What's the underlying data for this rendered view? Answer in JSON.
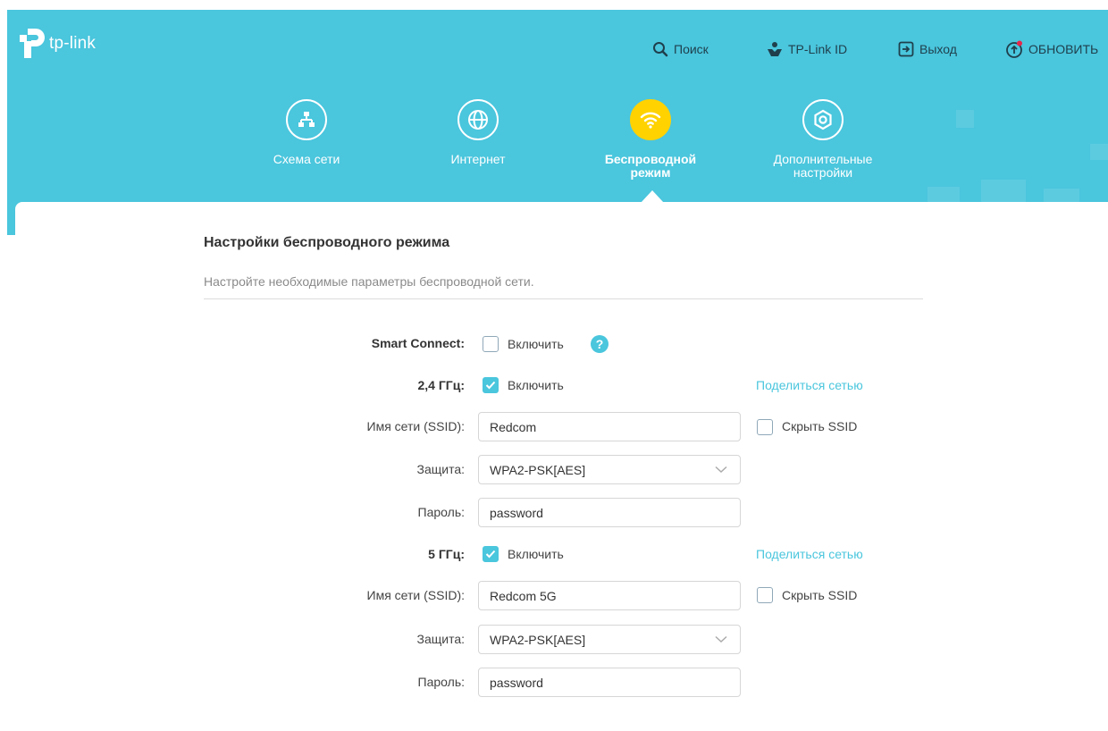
{
  "header": {
    "logo_text": "tp-link",
    "top_links": {
      "search": "Поиск",
      "tplink_id": "TP-Link ID",
      "logout": "Выход",
      "update": "ОБНОВИТЬ"
    },
    "nav": [
      {
        "line1": "Схема сети",
        "line2": "",
        "icon": "network-map-icon"
      },
      {
        "line1": "Интернет",
        "line2": "",
        "icon": "globe-icon"
      },
      {
        "line1": "Беспроводной",
        "line2": "режим",
        "icon": "wifi-icon",
        "active": true
      },
      {
        "line1": "Дополнительные",
        "line2": "настройки",
        "icon": "advanced-settings-icon"
      }
    ],
    "colors": {
      "primary": "#4ac6dd",
      "active_tab": "#ffd200"
    }
  },
  "section": {
    "title": "Настройки беспроводного режима",
    "subtitle": "Настройте необходимые параметры беспроводной сети."
  },
  "form": {
    "smart_connect": {
      "label": "Smart Connect:",
      "checkbox_label": "Включить",
      "checked": false
    },
    "band24": {
      "label": "2,4 ГГц:",
      "checkbox_label": "Включить",
      "checked": true,
      "share_link": "Поделиться сетью",
      "ssid_label": "Имя сети (SSID):",
      "ssid_value": "Redcom",
      "hide_ssid_label": "Скрыть SSID",
      "hide_ssid_checked": false,
      "security_label": "Защита:",
      "security_value": "WPA2-PSK[AES]",
      "password_label": "Пароль:",
      "password_value": "password"
    },
    "band5": {
      "label": "5 ГГц:",
      "checkbox_label": "Включить",
      "checked": true,
      "share_link": "Поделиться сетью",
      "ssid_label": "Имя сети (SSID):",
      "ssid_value": "Redcom 5G",
      "hide_ssid_label": "Скрыть SSID",
      "hide_ssid_checked": false,
      "security_label": "Защита:",
      "security_value": "WPA2-PSK[AES]",
      "password_label": "Пароль:",
      "password_value": "password"
    }
  }
}
